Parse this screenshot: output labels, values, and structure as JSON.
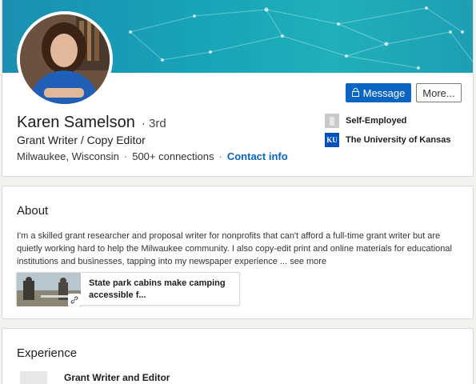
{
  "profile": {
    "name": "Karen Samelson",
    "degree": "· 3rd",
    "headline": "Grant Writer / Copy Editor",
    "location": "Milwaukee, Wisconsin",
    "separator": "·",
    "connections": "500+ connections",
    "contact_info": "Contact info",
    "actions": {
      "message_label": "Message",
      "more_label": "More..."
    },
    "organizations": [
      {
        "name": "Self-Employed",
        "icon": "building-icon"
      },
      {
        "name": "The University of Kansas",
        "icon": "ku-logo-icon",
        "logo_text": "KU"
      }
    ]
  },
  "about": {
    "title": "About",
    "text": "I'm a skilled grant researcher and proposal writer for nonprofits that can't afford a full-time grant writer but are quietly working hard to help the Milwaukee community. I also copy-edit print and online materials for educational institutions and businesses, tapping into my newspaper experience ...",
    "see_more": "see more",
    "media": {
      "title": "State park cabins make camping accessible f...",
      "icon": "link-icon"
    }
  },
  "experience": {
    "title": "Experience",
    "items": [
      {
        "role": "Grant Writer and Editor"
      }
    ]
  },
  "colors": {
    "accent": "#0a66c2",
    "banner": "#1ba3b8"
  }
}
